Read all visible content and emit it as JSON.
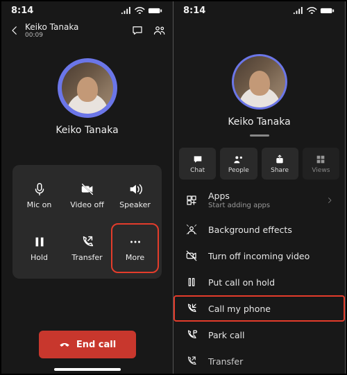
{
  "status": {
    "time": "8:14"
  },
  "left": {
    "header": {
      "name": "Keiko Tanaka",
      "duration": "00:09"
    },
    "profile_name": "Keiko Tanaka",
    "controls": {
      "mic": "Mic on",
      "video": "Video off",
      "speaker": "Speaker",
      "hold": "Hold",
      "transfer": "Transfer",
      "more": "More"
    },
    "end_call": "End call"
  },
  "right": {
    "profile_name": "Keiko Tanaka",
    "row": {
      "chat": "Chat",
      "people": "People",
      "share": "Share",
      "views": "Views"
    },
    "menu": {
      "apps_label": "Apps",
      "apps_sub": "Start adding apps",
      "bg_effects": "Background effects",
      "turn_off_video": "Turn off incoming video",
      "hold": "Put call on hold",
      "call_my_phone": "Call my phone",
      "park_call": "Park call",
      "transfer": "Transfer"
    }
  }
}
